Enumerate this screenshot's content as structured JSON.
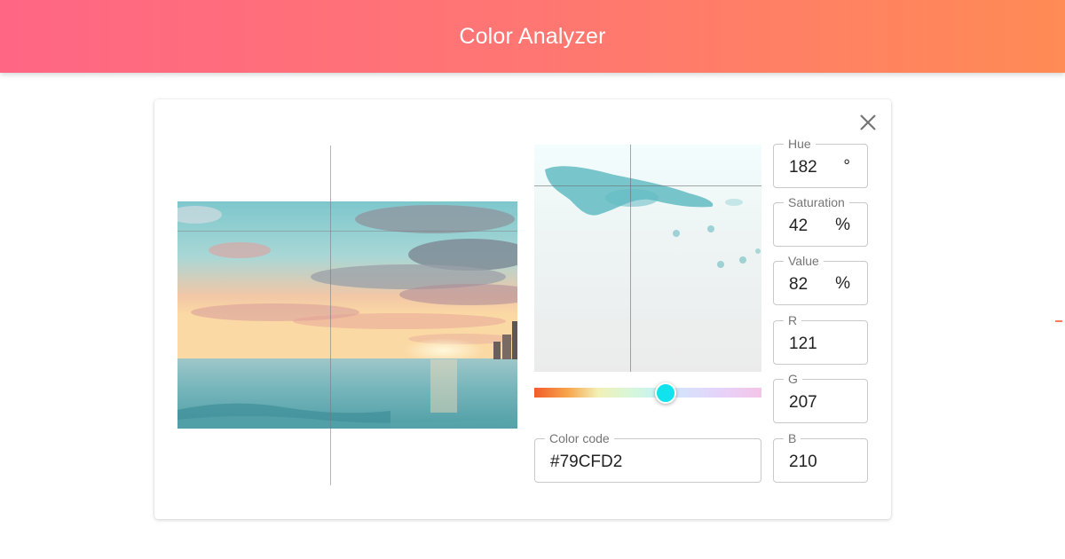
{
  "header": {
    "title": "Color Analyzer"
  },
  "color_code": {
    "label": "Color code",
    "value": "#79CFD2"
  },
  "hue_slider": {
    "position": 0.58
  },
  "fields": {
    "hue": {
      "label": "Hue",
      "value": "182",
      "unit": "°"
    },
    "saturation": {
      "label": "Saturation",
      "value": "42",
      "unit": "%"
    },
    "value": {
      "label": "Value",
      "value": "82",
      "unit": "%"
    },
    "r": {
      "label": "R",
      "value": "121"
    },
    "g": {
      "label": "G",
      "value": "207"
    },
    "b": {
      "label": "B",
      "value": "210"
    }
  },
  "icons": {
    "close": "close-icon"
  },
  "colors": {
    "selected": "#79CFD2",
    "header_start": "#ff6684",
    "header_end": "#ff8b55"
  }
}
